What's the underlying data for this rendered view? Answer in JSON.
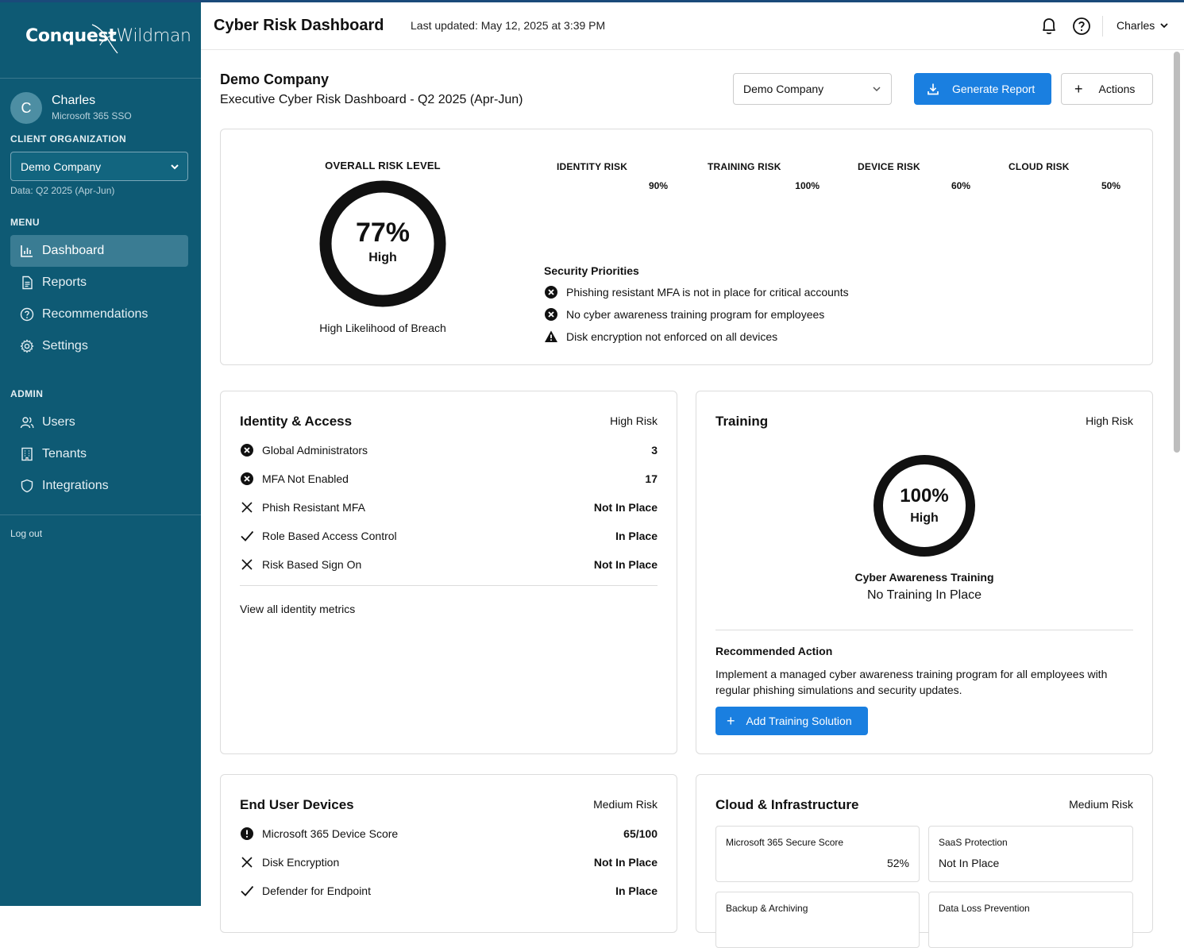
{
  "brand": {
    "logo_part1": "Conquest",
    "logo_part2": "Wildman"
  },
  "user": {
    "initial": "C",
    "name": "Charles",
    "auth": "Microsoft 365 SSO"
  },
  "client_org": {
    "label": "CLIENT ORGANIZATION",
    "selected": "Demo Company",
    "data_period": "Data: Q2 2025 (Apr-Jun)"
  },
  "menu": {
    "label": "MENU",
    "items": [
      {
        "label": "Dashboard",
        "icon": "bar-chart-icon",
        "active": true
      },
      {
        "label": "Reports",
        "icon": "document-icon"
      },
      {
        "label": "Recommendations",
        "icon": "question-circle-icon"
      },
      {
        "label": "Settings",
        "icon": "gear-icon"
      }
    ]
  },
  "admin": {
    "label": "ADMIN",
    "items": [
      {
        "label": "Users",
        "icon": "users-icon"
      },
      {
        "label": "Tenants",
        "icon": "building-icon"
      },
      {
        "label": "Integrations",
        "icon": "shield-icon"
      }
    ]
  },
  "logout": "Log out",
  "topbar": {
    "title": "Cyber Risk Dashboard",
    "updated": "Last updated: May 12, 2025 at 3:39 PM",
    "user": "Charles"
  },
  "header": {
    "company": "Demo Company",
    "subtitle": "Executive Cyber Risk Dashboard - Q2 2025 (Apr-Jun)",
    "company_select": "Demo Company",
    "generate_label": "Generate Report",
    "actions_label": "Actions"
  },
  "overall": {
    "label": "OVERALL RISK LEVEL",
    "percent": "77%",
    "level": "High",
    "breach": "High Likelihood of Breach",
    "risks": [
      {
        "label": "IDENTITY RISK",
        "value": "90%"
      },
      {
        "label": "TRAINING RISK",
        "value": "100%"
      },
      {
        "label": "DEVICE RISK",
        "value": "60%"
      },
      {
        "label": "CLOUD RISK",
        "value": "50%"
      }
    ],
    "priorities_title": "Security Priorities",
    "priorities": [
      {
        "text": "Phishing resistant MFA is not in place for critical accounts",
        "icon": "x-circle-icon"
      },
      {
        "text": "No cyber awareness training program for employees",
        "icon": "x-circle-icon"
      },
      {
        "text": "Disk encryption not enforced on all devices",
        "icon": "warning-icon"
      }
    ]
  },
  "identity": {
    "title": "Identity & Access",
    "risk": "High Risk",
    "metrics": [
      {
        "label": "Global Administrators",
        "value": "3",
        "icon": "x-circle-icon"
      },
      {
        "label": "MFA Not Enabled",
        "value": "17",
        "icon": "x-circle-icon"
      },
      {
        "label": "Phish Resistant MFA",
        "value": "Not In Place",
        "icon": "x-mark-icon"
      },
      {
        "label": "Role Based Access Control",
        "value": "In Place",
        "icon": "check-icon"
      },
      {
        "label": "Risk Based Sign On",
        "value": "Not In Place",
        "icon": "x-mark-icon"
      }
    ],
    "view_all": "View all identity metrics"
  },
  "training": {
    "title": "Training",
    "risk": "High Risk",
    "percent": "100%",
    "level": "High",
    "name": "Cyber Awareness Training",
    "status": "No Training In Place",
    "rec_title": "Recommended Action",
    "rec_text": "Implement a managed cyber awareness training program for all employees with regular phishing simulations and security updates.",
    "button": "Add Training Solution"
  },
  "devices": {
    "title": "End User Devices",
    "risk": "Medium Risk",
    "metrics": [
      {
        "label": "Microsoft 365 Device Score",
        "value": "65/100",
        "icon": "exclamation-circle-icon"
      },
      {
        "label": "Disk Encryption",
        "value": "Not In Place",
        "icon": "x-mark-icon"
      },
      {
        "label": "Defender for Endpoint",
        "value": "In Place",
        "icon": "check-icon"
      }
    ]
  },
  "cloud": {
    "title": "Cloud & Infrastructure",
    "risk": "Medium Risk",
    "tiles": [
      {
        "label": "Microsoft 365 Secure Score",
        "value": "52%"
      },
      {
        "label": "SaaS Protection",
        "value": "Not In Place"
      },
      {
        "label": "Backup & Archiving",
        "value": ""
      },
      {
        "label": "Data Loss Prevention",
        "value": ""
      }
    ]
  }
}
